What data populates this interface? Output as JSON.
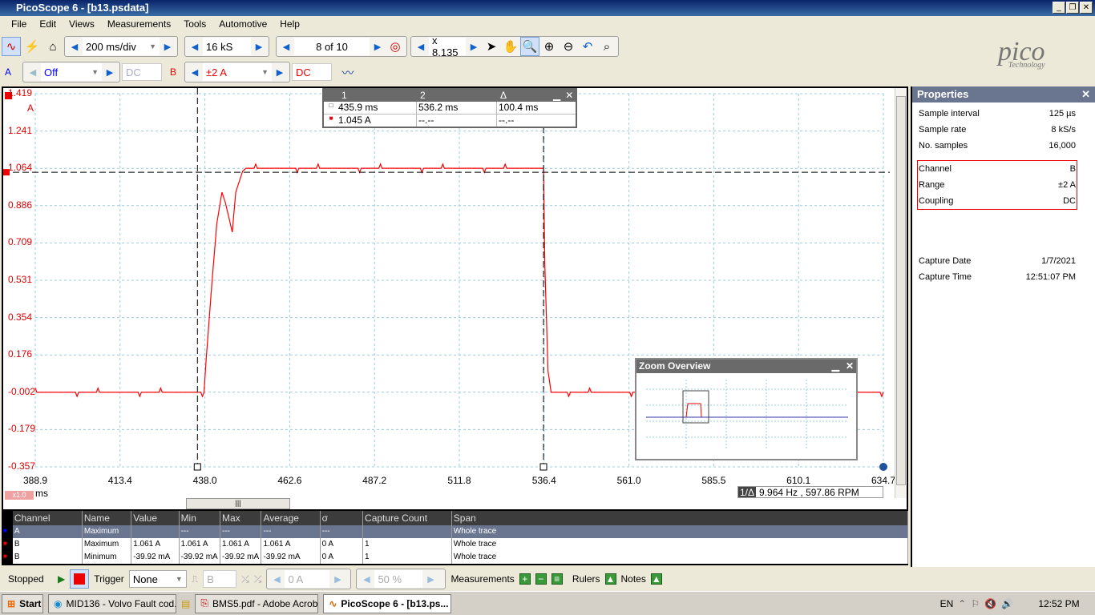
{
  "window": {
    "title": "PicoScope 6 - [b13.psdata]",
    "controls": [
      "_",
      "❐",
      "✕"
    ]
  },
  "menu": [
    "File",
    "Edit",
    "Views",
    "Measurements",
    "Tools",
    "Automotive",
    "Help"
  ],
  "toolbar": {
    "timebase": "200 ms/div",
    "samples": "16 kS",
    "buffer": "8 of 10",
    "zoom": "x 8.135"
  },
  "channels": {
    "a": {
      "label": "A",
      "range": "Off",
      "coupling": "DC",
      "color": "#0000ff"
    },
    "b": {
      "label": "B",
      "range": "±2 A",
      "coupling": "DC",
      "color": "#e00000"
    }
  },
  "logo": {
    "text": "pico",
    "sub": "Technology"
  },
  "plot": {
    "y_unit": "A",
    "x_unit": "ms",
    "zoom_badge": "x1.0",
    "y_ticks": [
      "1.419",
      "1.241",
      "1.064",
      "0.886",
      "0.709",
      "0.531",
      "0.354",
      "0.176",
      "-0.002",
      "-0.179",
      "-0.357"
    ],
    "x_ticks": [
      "388.9",
      "413.4",
      "438.0",
      "462.6",
      "487.2",
      "511.8",
      "536.4",
      "561.0",
      "585.5",
      "610.1",
      "634.7"
    ],
    "frequency": "9.964 Hz , 597.86 RPM",
    "frequency_label": "1/Δ",
    "trace_color": "#ff0000",
    "trace": [
      [
        388.9,
        -0.002
      ],
      [
        437.8,
        -0.002
      ],
      [
        438.4,
        0.15
      ],
      [
        440,
        0.5
      ],
      [
        441.5,
        0.8
      ],
      [
        443,
        0.95
      ],
      [
        444,
        0.9
      ],
      [
        446,
        0.76
      ],
      [
        447,
        0.95
      ],
      [
        449,
        1.05
      ],
      [
        450,
        1.064
      ],
      [
        536.2,
        1.064
      ],
      [
        536.6,
        0.6
      ],
      [
        537.5,
        0.1
      ],
      [
        538.4,
        -0.002
      ],
      [
        634.7,
        -0.002
      ]
    ],
    "ruler_time": [
      435.9,
      536.2
    ],
    "ruler_level": 1.045
  },
  "ruler_table": {
    "headers": [
      "1",
      "2",
      "Δ"
    ],
    "rows": [
      [
        "435.9 ms",
        "536.2 ms",
        "100.4 ms"
      ],
      [
        "1.045 A",
        "--.--",
        "--.--"
      ]
    ]
  },
  "zoom_overview": {
    "title": "Zoom Overview"
  },
  "properties": {
    "title": "Properties",
    "rows": [
      [
        "Sample interval",
        "125 µs"
      ],
      [
        "Sample rate",
        "8 kS/s"
      ],
      [
        "No. samples",
        "16,000"
      ]
    ],
    "channel_rows": [
      [
        "Channel",
        "B"
      ],
      [
        "Range",
        "±2 A"
      ],
      [
        "Coupling",
        "DC"
      ]
    ],
    "capture_rows": [
      [
        "Capture Date",
        "1/7/2021"
      ],
      [
        "Capture Time",
        "12:51:07 PM"
      ]
    ]
  },
  "measurements": {
    "headers": [
      "Channel",
      "Name",
      "Value",
      "Min",
      "Max",
      "Average",
      "σ",
      "Capture Count",
      "Span"
    ],
    "rows": [
      [
        "A",
        "Maximum",
        "",
        "---",
        "---",
        "---",
        "---",
        "",
        "Whole trace"
      ],
      [
        "B",
        "Maximum",
        "1.061 A",
        "1.061 A",
        "1.061 A",
        "1.061 A",
        "0 A",
        "1",
        "Whole trace"
      ],
      [
        "B",
        "Minimum",
        "-39.92 mA",
        "-39.92 mA",
        "-39.92 mA",
        "-39.92 mA",
        "0 A",
        "1",
        "Whole trace"
      ]
    ]
  },
  "status": {
    "state": "Stopped",
    "trigger_label": "Trigger",
    "trigger": "None",
    "trigger_channel": "B",
    "threshold": "0 A",
    "pretrigger": "50 %",
    "measurements": "Measurements",
    "rulers": "Rulers",
    "notes": "Notes"
  },
  "taskbar": {
    "start": "Start",
    "tasks": [
      "MID136 - Volvo Fault cod...",
      "BMS5.pdf - Adobe Acrob...",
      "PicoScope 6 - [b13.ps..."
    ],
    "lang": "EN",
    "clock": "12:52 PM"
  }
}
